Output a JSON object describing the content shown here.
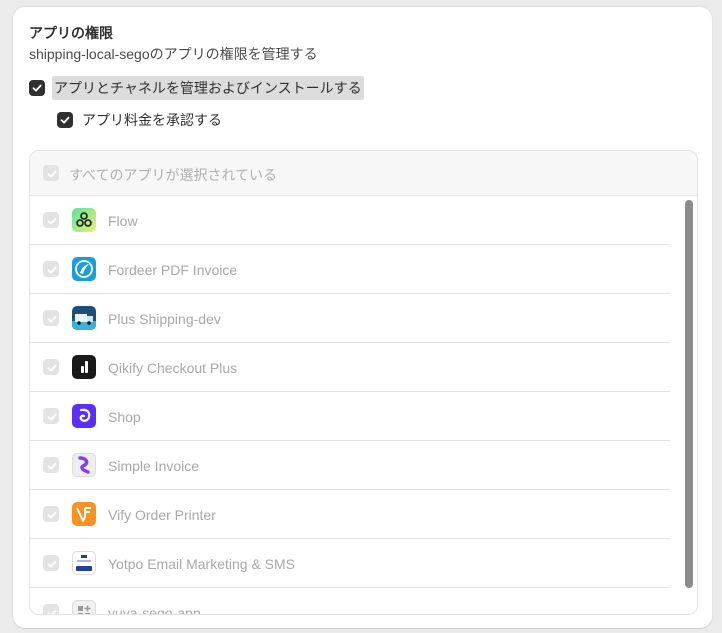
{
  "section": {
    "title": "アプリの権限",
    "subtitle": "shipping-local-segoのアプリの権限を管理する"
  },
  "permissions": [
    {
      "label": "アプリとチャネルを管理およびインストールする",
      "checked": true
    },
    {
      "label": "アプリ料金を承認する",
      "checked": true
    }
  ],
  "app_list": {
    "select_all_label": "すべてのアプリが選択されている",
    "apps": [
      {
        "name": "Flow",
        "icon": "flow-icon",
        "checked": true
      },
      {
        "name": "Fordeer PDF Invoice",
        "icon": "fordeer-icon",
        "checked": true
      },
      {
        "name": "Plus Shipping-dev",
        "icon": "truck-icon",
        "checked": true
      },
      {
        "name": "Qikify Checkout Plus",
        "icon": "qikify-icon",
        "checked": true
      },
      {
        "name": "Shop",
        "icon": "shop-icon",
        "checked": true
      },
      {
        "name": "Simple Invoice",
        "icon": "simple-invoice-icon",
        "checked": true
      },
      {
        "name": "Vify Order Printer",
        "icon": "vify-icon",
        "checked": true
      },
      {
        "name": "Yotpo Email Marketing & SMS",
        "icon": "yotpo-icon",
        "checked": true
      },
      {
        "name": "yuya-sego-app",
        "icon": "app-placeholder-icon",
        "checked": true
      }
    ]
  },
  "colors": {
    "checkbox_active": "#303030",
    "checkbox_disabled": "#e3e3e3",
    "muted_text": "#a8a8a8"
  }
}
